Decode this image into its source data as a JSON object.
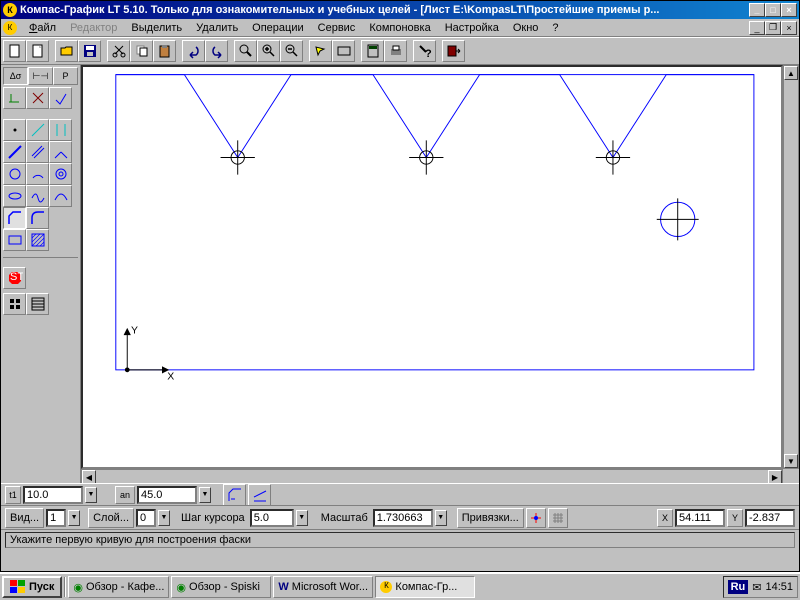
{
  "title": "Компас-График LT 5.10. Только для ознакомительных и учебных целей - [Лист E:\\KompasLT\\Простейшие приемы р...",
  "menu": {
    "file": "Файл",
    "editor": "Редактор",
    "select": "Выделить",
    "delete": "Удалить",
    "operations": "Операции",
    "service": "Сервис",
    "layout": "Компоновка",
    "settings": "Настройка",
    "window": "Окно",
    "help": "?"
  },
  "tabs": {
    "t1": "Δσ",
    "t2": "⊢⊣",
    "t3": "Р"
  },
  "stop": "STOP",
  "params": {
    "t1_label": "t1",
    "t1_value": "10.0",
    "an_label": "an",
    "an_value": "45.0"
  },
  "status2": {
    "view": "Вид...",
    "view_val": "1",
    "layer": "Слой...",
    "layer_val": "0",
    "cursor_step": "Шаг курсора",
    "cursor_step_val": "5.0",
    "scale": "Масштаб",
    "scale_val": "1.730663",
    "snaps": "Привязки...",
    "x_label": "X",
    "x_val": "54.111",
    "y_label": "Y",
    "y_val": "-2.837"
  },
  "statusbar": {
    "hint": "Укажите первую кривую для построения фаски"
  },
  "taskbar": {
    "start": "Пуск",
    "t1": "Обзор - Кафе...",
    "t2": "Обзор - Spiski",
    "t3": "Microsoft Wor...",
    "t4": "Компас-Гр...",
    "lang": "Ru",
    "time": "14:51"
  },
  "axes": {
    "x": "X",
    "y": "Y"
  }
}
